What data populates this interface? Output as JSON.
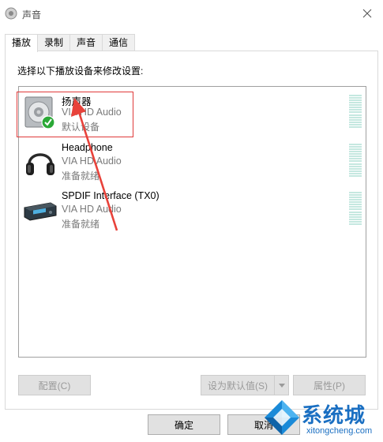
{
  "window": {
    "title": "声音",
    "close_icon": "close-icon"
  },
  "tabs": [
    {
      "label": "播放",
      "active": true
    },
    {
      "label": "录制",
      "active": false
    },
    {
      "label": "声音",
      "active": false
    },
    {
      "label": "通信",
      "active": false
    }
  ],
  "panel": {
    "instruction": "选择以下播放设备来修改设置:"
  },
  "devices": [
    {
      "name": "扬声器",
      "driver": "VIA HD Audio",
      "status": "默认设备",
      "icon": "speaker-icon",
      "default": true
    },
    {
      "name": "Headphone",
      "driver": "VIA HD Audio",
      "status": "准备就绪",
      "icon": "headphone-icon",
      "default": false
    },
    {
      "name": "SPDIF Interface (TX0)",
      "driver": "VIA HD Audio",
      "status": "准备就绪",
      "icon": "spdif-icon",
      "default": false
    }
  ],
  "buttons": {
    "configure": "配置(C)",
    "set_default": "设为默认值(S)",
    "properties": "属性(P)",
    "ok": "确定",
    "cancel": "取消"
  },
  "watermark": {
    "brand": "系统城",
    "url": "xitongcheng.com"
  },
  "colors": {
    "highlight": "#e03a3a",
    "level_meter": "#c5e8e0",
    "watermark": "#1a6fc2"
  }
}
